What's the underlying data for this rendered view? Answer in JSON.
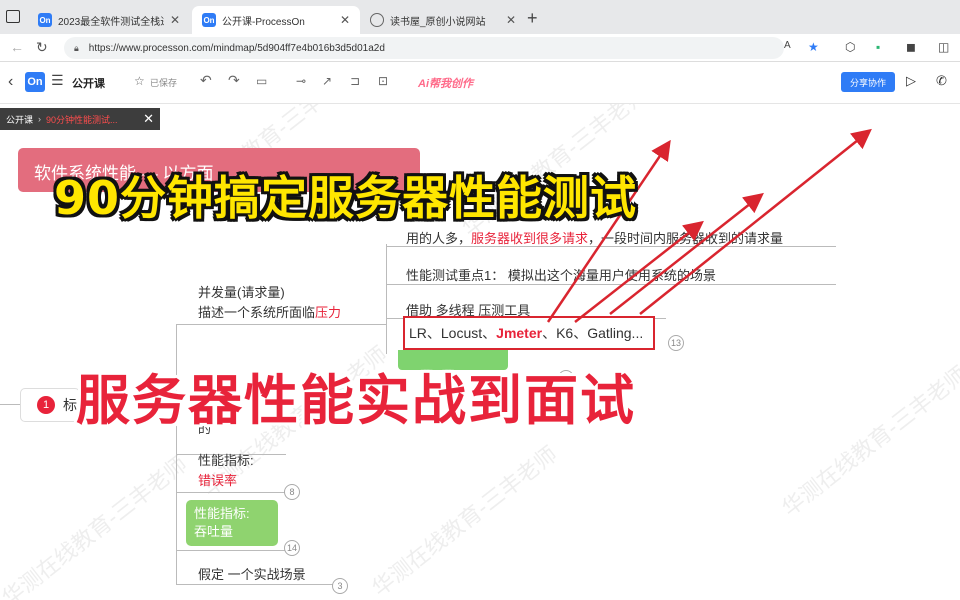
{
  "browser": {
    "tabs": [
      {
        "title": "2023最全软件测试全栈进阶知识",
        "favicon": "On",
        "active": false
      },
      {
        "title": "公开课-ProcessOn",
        "favicon": "On",
        "active": true
      },
      {
        "title": "读书屋_原创小说网站",
        "favicon": "globe-icon",
        "active": false
      }
    ],
    "url": "https://www.processon.com/mindmap/5d904ff7e4b016b3d5d01a2d",
    "read_aloud_label": "A"
  },
  "toolbar": {
    "logo": "On",
    "doc_title": "公开课",
    "saved_label": "已保存",
    "ai_label": "Ai帮我创作",
    "share_label": "分享协作"
  },
  "breadcrumb": {
    "root": "公开课",
    "current": "90分钟性能测试..."
  },
  "headline": {
    "top": "90分钟搞定服务器性能测试",
    "bottom": "服务器性能实战到面试"
  },
  "mindmap": {
    "pink_node": "软件系统性能 — 以方面 ...",
    "right_items": [
      {
        "pre": "用的人多，",
        "hl": "服务器收到很多请求",
        "post": "，一段时间内服务器收到的请求量"
      },
      {
        "pre": "性能测试重点1：  模拟出这个海量用户使用系统的场景",
        "hl": "",
        "post": ""
      },
      {
        "pre": "借助 多线程 压测工具",
        "hl": "",
        "post": ""
      }
    ],
    "tools_line": {
      "pre": "LR、Locust、",
      "hl": "Jmeter",
      "post": "、K6、Gatling..."
    },
    "left_items": {
      "concurrency_title": "并发量(请求量)",
      "concurrency_desc_pre": "描述一个系统所面临",
      "concurrency_desc_hl": "压力",
      "error_label": "性能指标:",
      "error_value": "错误率",
      "tps_label": "性能指标:",
      "tps_value": "吞吐量",
      "scenario": "假定 一个实战场景",
      "partial_zh": "的"
    },
    "num_node": {
      "num": "1",
      "text": "标"
    },
    "badges": [
      "13",
      "2",
      "8",
      "14",
      "3"
    ]
  },
  "watermark_text": "华测在线教育-三丰老师",
  "colors": {
    "accent": "#2f7cf6",
    "headline_yellow": "#ffe600",
    "headline_red": "#e8233a",
    "pink_node": "#e36d7e",
    "green_node": "#8fd36f",
    "arrow_red": "#d9252f"
  }
}
